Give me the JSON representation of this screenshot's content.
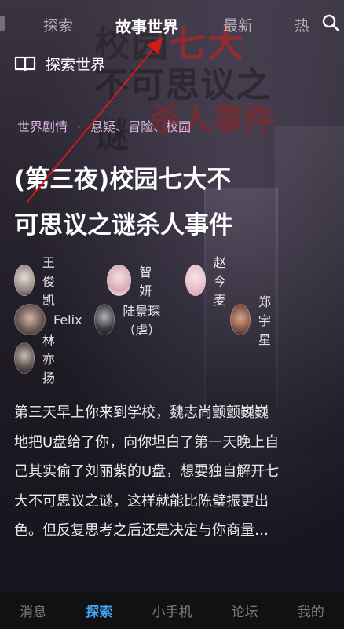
{
  "poster": {
    "line1_a": "校园",
    "line1_b": "七大",
    "line2": "不可思议之谜",
    "line3": "杀人事件"
  },
  "top_nav": {
    "tabs": [
      {
        "label": "探索"
      },
      {
        "label": "故事世界"
      },
      {
        "label": "最新"
      },
      {
        "label": "热"
      }
    ],
    "active_index": 1
  },
  "section": {
    "label": "探索世界",
    "icon": "book-icon"
  },
  "tags": {
    "prefix": "世界剧情",
    "genres": "悬疑、冒险、校园"
  },
  "story": {
    "title_line1": "(第三夜)校园七大不",
    "title_line2": "可思议之谜杀人事件"
  },
  "characters": [
    {
      "name": "王俊凯"
    },
    {
      "name": "智妍"
    },
    {
      "name": "赵今麦"
    },
    {
      "name": "Felix"
    },
    {
      "name": "陆景琛（虐）"
    },
    {
      "name": "郑宇星"
    },
    {
      "name": "林亦扬"
    }
  ],
  "description": {
    "l1": "第三天早上你来到学校，魏志尚颤颤巍巍",
    "l2": "地把U盘给了你，向你坦白了第一天晚上自",
    "l3": "己其实偷了刘丽紫的U盘，想要独自解开七",
    "l4": "大不可思议之谜，这样就能比陈璧振更出",
    "l5": "色。但反复思考之后还是决定与你商量…"
  },
  "bottom_nav": {
    "items": [
      {
        "label": "消息"
      },
      {
        "label": "探索"
      },
      {
        "label": "小手机"
      },
      {
        "label": "论坛"
      },
      {
        "label": "我的"
      }
    ],
    "active_index": 1
  },
  "colors": {
    "accent_blue": "#3fa6f5",
    "tag_purple": "#d9b9e2",
    "arrow_red": "#d11a1a"
  }
}
